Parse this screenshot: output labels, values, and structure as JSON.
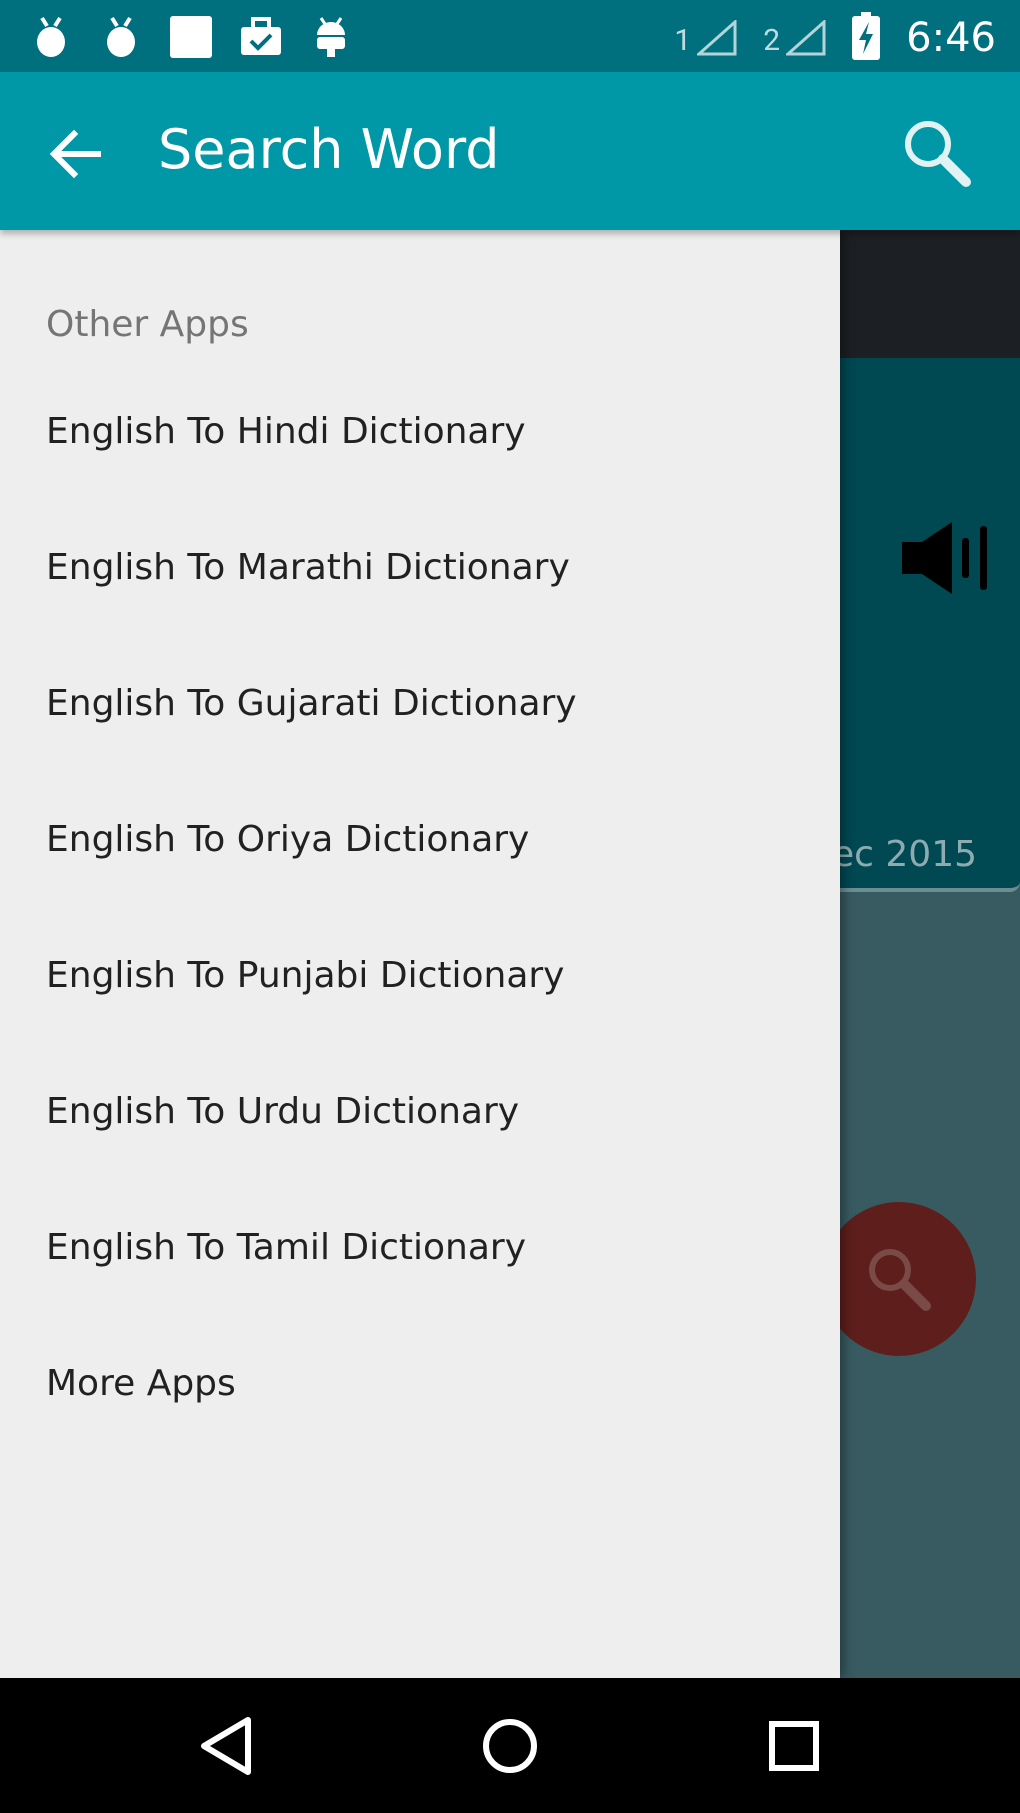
{
  "status_bar": {
    "sim1_label": "1",
    "sim2_label": "2",
    "time": "6:46",
    "icons": [
      "notification-bug-icon",
      "notification-bug-icon",
      "notification-square-icon",
      "notification-briefcase-check-icon",
      "notification-android-icon"
    ]
  },
  "app_bar": {
    "title": "Search Word",
    "color": "#0097a7"
  },
  "background": {
    "date_fragment": "ec 2015"
  },
  "drawer": {
    "header": "Other Apps",
    "items": [
      {
        "label": "English To Hindi Dictionary"
      },
      {
        "label": "English To Marathi Dictionary"
      },
      {
        "label": "English To Gujarati Dictionary"
      },
      {
        "label": "English To Oriya Dictionary"
      },
      {
        "label": "English To Punjabi Dictionary"
      },
      {
        "label": "English To Urdu Dictionary"
      },
      {
        "label": "English To Tamil Dictionary"
      },
      {
        "label": "More Apps"
      }
    ]
  }
}
